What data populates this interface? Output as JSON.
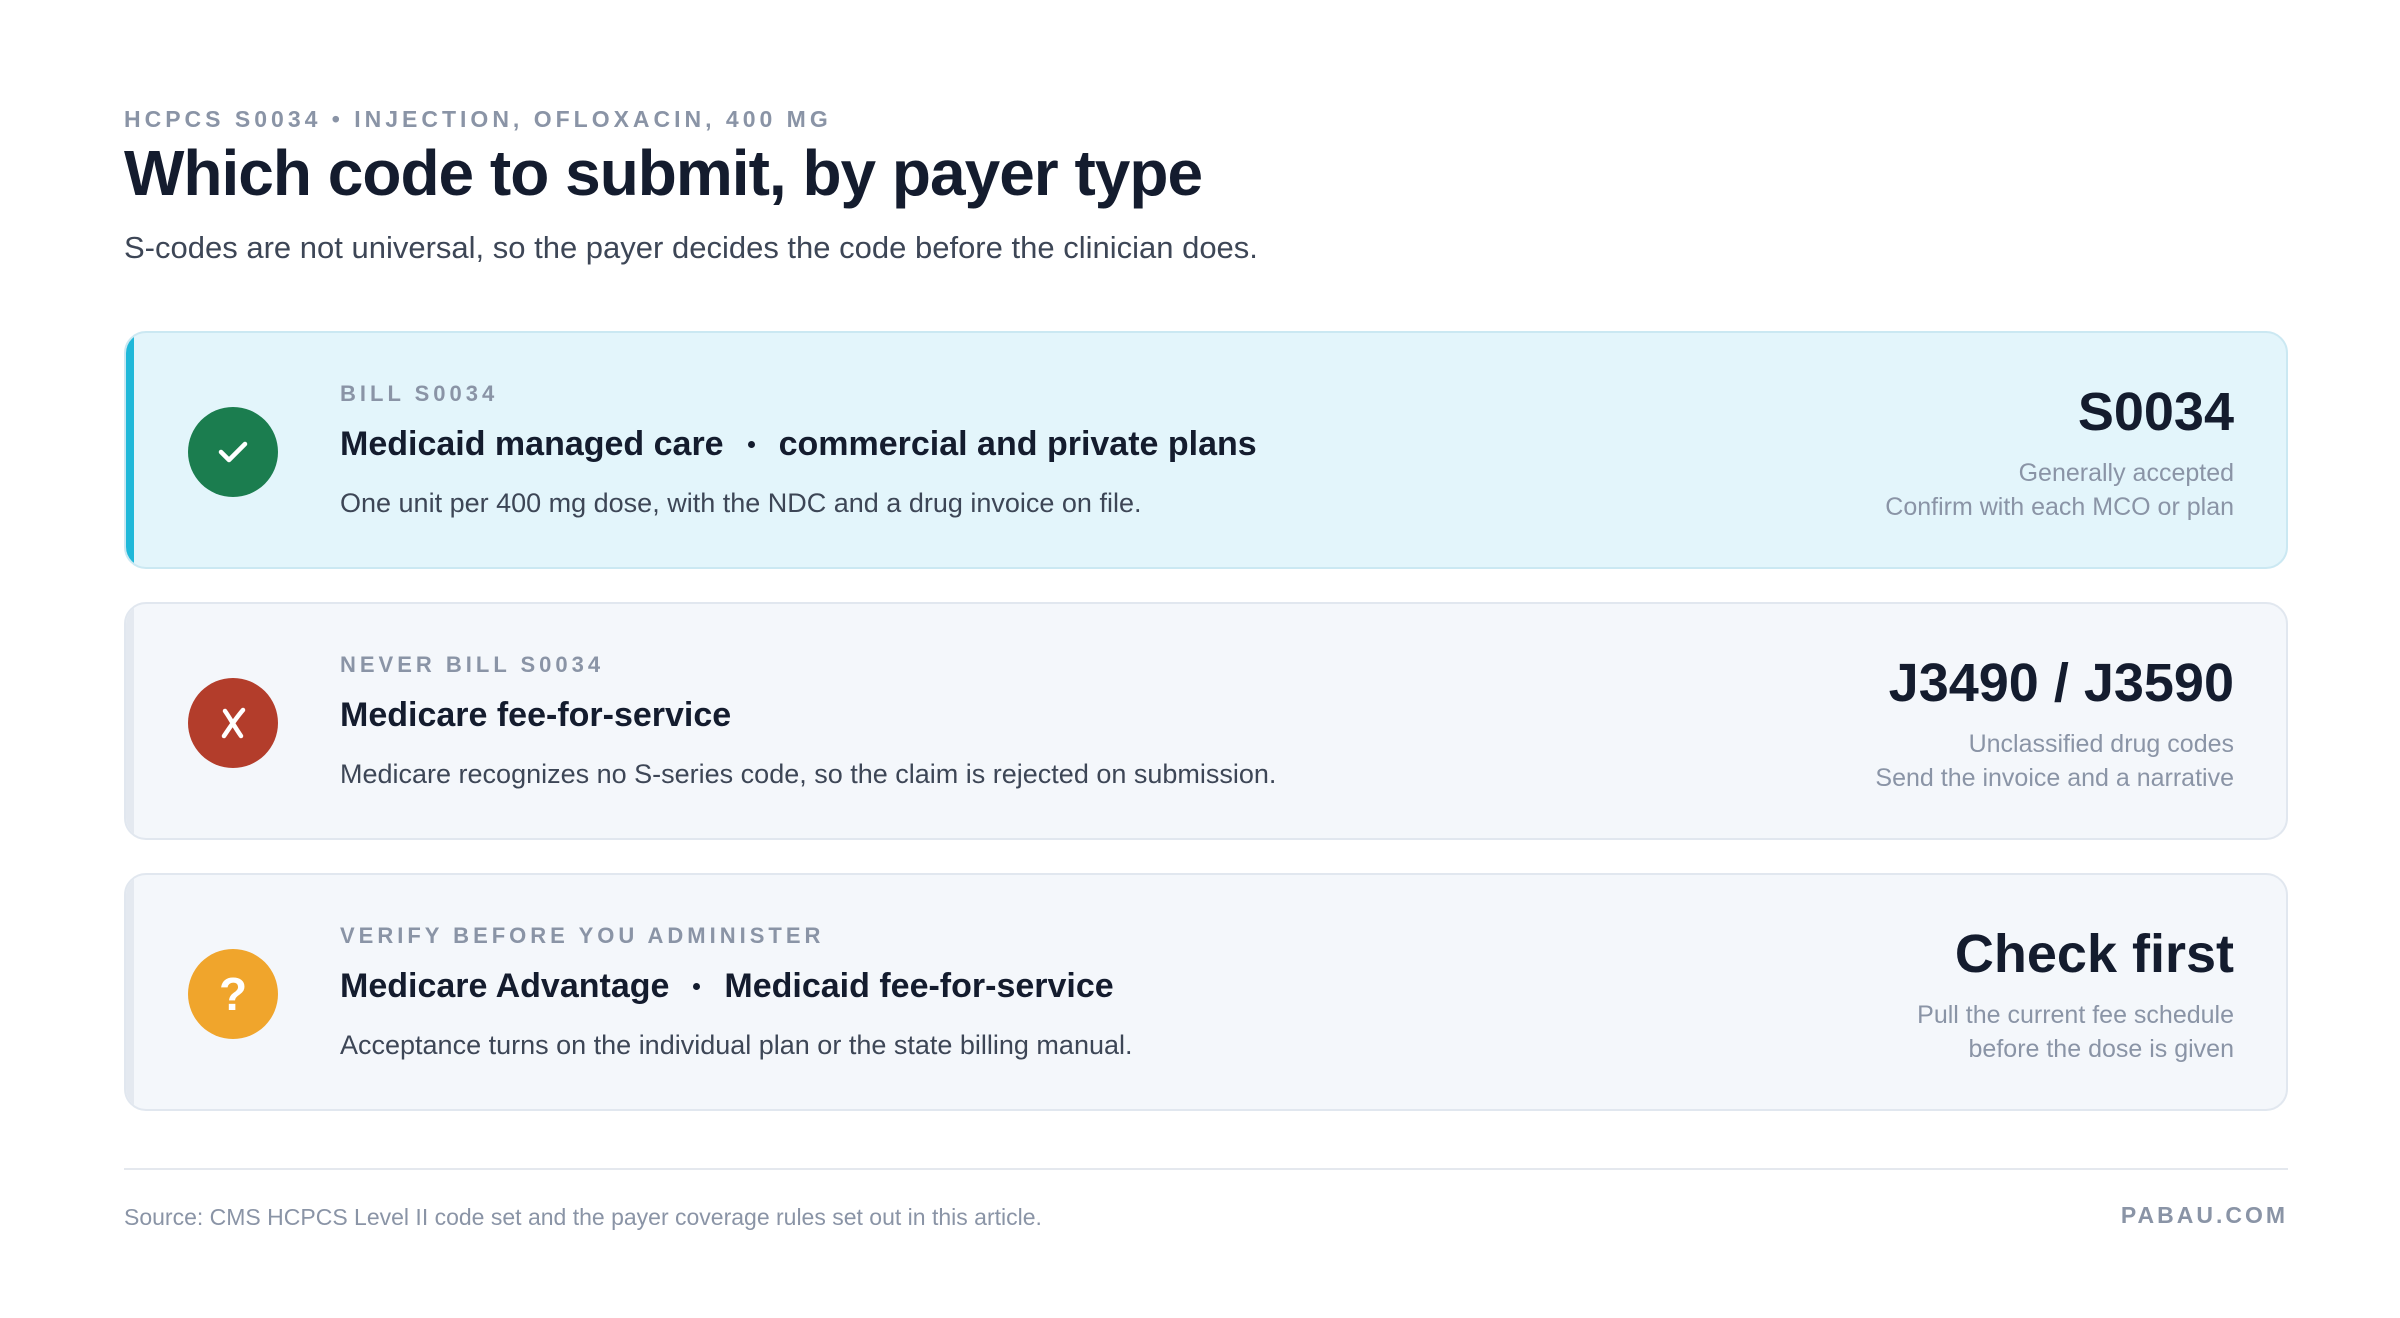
{
  "header": {
    "eyebrow": "HCPCS S0034 • INJECTION, OFLOXACIN, 400 MG",
    "title": "Which code to submit, by payer type",
    "subtitle": "S-codes are not universal, so the payer decides the code before the clinician does."
  },
  "cards": [
    {
      "status": "accepted",
      "icon": "check-icon",
      "color": "#1b7d4f",
      "label": "BILL S0034",
      "payers": [
        "Medicaid managed care",
        "commercial and private plans"
      ],
      "description": "One unit per 400 mg dose, with the NDC and a drug invoice on file.",
      "code": "S0034",
      "note_line1": "Generally accepted",
      "note_line2": "Confirm with each MCO or plan"
    },
    {
      "status": "rejected",
      "icon": "cross-icon",
      "color": "#b33d2b",
      "label": "NEVER BILL S0034",
      "payers": [
        "Medicare fee-for-service"
      ],
      "description": "Medicare recognizes no S-series code, so the claim is rejected on submission.",
      "code": "J3490 / J3590",
      "note_line1": "Unclassified drug codes",
      "note_line2": "Send the invoice and a narrative"
    },
    {
      "status": "verify",
      "icon": "question-icon",
      "color": "#f0a52c",
      "label": "VERIFY BEFORE YOU ADMINISTER",
      "payers": [
        "Medicare Advantage",
        "Medicaid fee-for-service"
      ],
      "description": "Acceptance turns on the individual plan or the state billing manual.",
      "code": "Check first",
      "note_line1": "Pull the current fee schedule",
      "note_line2": "before the dose is given"
    }
  ],
  "footer": {
    "source": "Source: CMS HCPCS Level II code set and the payer coverage rules set out in this article.",
    "brand": "PABAU.COM"
  },
  "colors": {
    "accent": "#1fb8d9",
    "ink": "#141c2e",
    "muted": "#8a94a6"
  }
}
